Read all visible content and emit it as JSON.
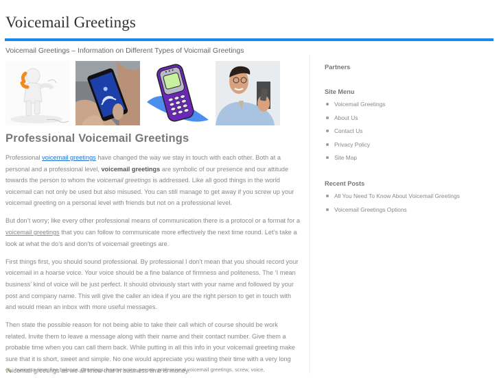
{
  "header": {
    "site_title": "Voicemail Greetings",
    "tagline": "Voicemail Greetings – Information on Different Types of Voicmail Greetings",
    "accent_color": "#1a86ee"
  },
  "images": [
    {
      "name": "3d-figure-on-phone-image",
      "alt": "3D white figure holding an orange phone"
    },
    {
      "name": "smartphone-voicemail-image",
      "alt": "Hands holding a smartphone showing voicemail"
    },
    {
      "name": "purple-cellphone-clipart-image",
      "alt": "Purple cartoon mobile phone"
    },
    {
      "name": "man-with-phone-image",
      "alt": "Smiling man holding a mobile phone"
    }
  ],
  "post": {
    "title": "Professional Voicemail Greetings",
    "p1": {
      "t1": "Professional ",
      "link1": "voicemail greetings",
      "t2": " have changed the way we stay in touch with each other. Both at a personal and a professional level, ",
      "bold1": "voicemail greetings",
      "t3": " are symbolic of our presence and our attitude towards the person to whom the ",
      "italic1": "voicemail greetings",
      "t4": " is addressed. Like all good things in the world voicemail can not only be used but also misused. You can still manage to get away if you screw up your voicemail greeting on a personal level with friends but not on a professional level."
    },
    "p2": {
      "t1": "But don’t worry; like every other professional means of communication there is a protocol or a format for a ",
      "link1": "voicemail greetings",
      "t2": " that you can follow to communicate more effectively the next time round. Let’s take a look at what the do’s and don’ts of voicemail greetings are."
    },
    "p3": "First things first, you should sound professional. By professional I don’t mean that you should record your voicemail in a hoarse voice. Your voice should be a fine balance of firmness and politeness. The ‘I mean business’ kind of voice will be just perfect. It should obviously start with your name and followed by your post and company name. This will give the caller an idea if you are the right person to get in touch with and would mean an inbox with more useful messages.",
    "p4": "Then state the possible reason for not being able to take their call which of course should be work related. Invite them to leave a message along with their name and their contact number. Give them a probable time when you can call them back. While putting in all this info in your voicemail greeting make sure that it is short, sweet and simple. No one would appreciate you wasting their time with a very long voicemail greetings as we all know that in business time is money.",
    "tags_icon": "tag-icon",
    "tags": "business time, fine balance, Greetings, hoarse voice, person, professional voicemail greetings, screw, voice,"
  },
  "sidebar": {
    "partners": {
      "title": "Partners"
    },
    "site_menu": {
      "title": "Site Menu",
      "items": [
        "Voicemail Greetings",
        "About Us",
        "Contact Us",
        "Privacy Policy",
        "Site Map"
      ]
    },
    "recent_posts": {
      "title": "Recent Posts",
      "items": [
        "All You Need To Know About Voicemail Greetings",
        "Voicemail Greetings Options"
      ]
    }
  }
}
